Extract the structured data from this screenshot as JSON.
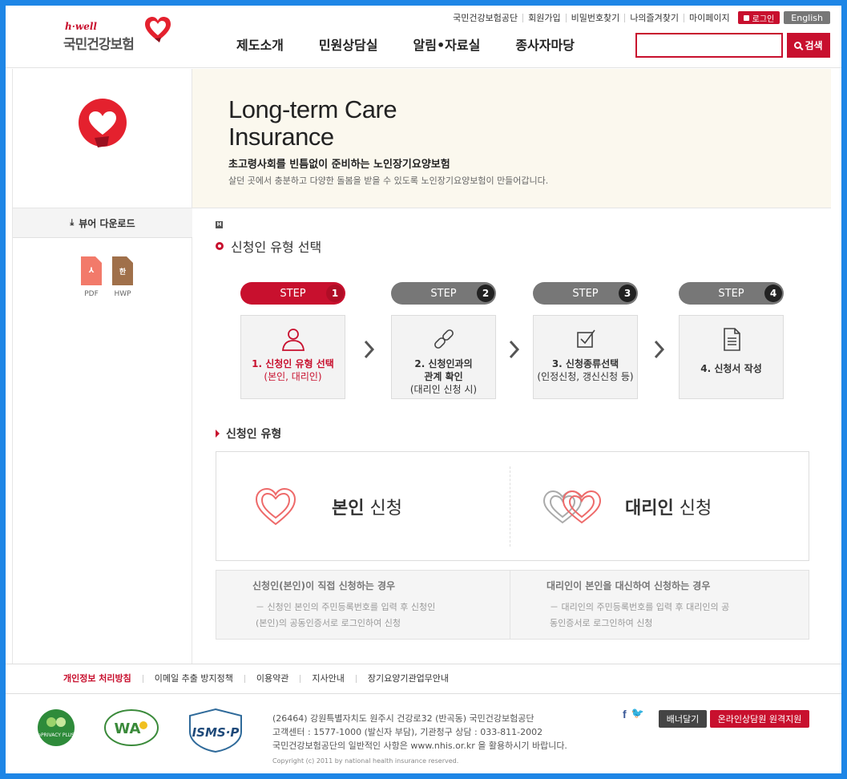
{
  "header": {
    "logo_tagline": "h·well",
    "logo_name": "국민건강보험",
    "util_links": [
      "국민건강보험공단",
      "회원가입",
      "비밀번호찾기",
      "나의즐겨찾기",
      "마이페이지"
    ],
    "login_label": "로그인",
    "english_label": "English",
    "menu": [
      "제도소개",
      "민원상담실",
      "알림•자료실",
      "종사자마당"
    ],
    "search_value": "",
    "search_label": "검색"
  },
  "banner": {
    "title_line1": "Long-term Care",
    "title_line2": "Insurance",
    "subtitle": "초고령사회를 빈틈없이 준비하는 노인장기요양보험",
    "description": "살던 곳에서 충분하고 다양한 돌봄을 받을 수 있도록 노인장기요양보험이 만들어갑니다."
  },
  "sidebar": {
    "viewer_title": "뷰어 다운로드",
    "downloads": [
      {
        "label": "PDF",
        "glyph": "⅄",
        "color": "#f27a6a",
        "icon": "pdf-icon"
      },
      {
        "label": "HWP",
        "glyph": "한",
        "color": "#a0704a",
        "icon": "hwp-icon"
      }
    ]
  },
  "page": {
    "heading": "신청인 유형 선택",
    "steps": [
      {
        "step": "STEP",
        "num": "1",
        "label": "1. 신청인 유형 선택",
        "sub": "(본인, 대리인)",
        "icon": "person-icon",
        "active": true
      },
      {
        "step": "STEP",
        "num": "2",
        "label": "2. 신청인과의 관계 확인",
        "sub": "(대리인 신청 시)",
        "icon": "link-icon",
        "active": false
      },
      {
        "step": "STEP",
        "num": "3",
        "label": "3. 신청종류선택",
        "sub": "(인정신청, 갱신신청 등)",
        "icon": "checkbox-icon",
        "active": false
      },
      {
        "step": "STEP",
        "num": "4",
        "label": "4. 신청서 작성",
        "sub": "",
        "icon": "document-icon",
        "active": false
      }
    ],
    "type_heading": "신청인 유형",
    "types": [
      {
        "bold": "본인",
        "rest": " 신청"
      },
      {
        "bold": "대리인",
        "rest": " 신청"
      }
    ],
    "descriptions": [
      {
        "title": "신청인(본인)이 직접 신청하는 경우",
        "line1": "－ 신청인 본인의 주민등록번호를 입력 후 신청인",
        "line2": "(본인)의 공동인증서로 로그인하여 신청"
      },
      {
        "title": "대리인이 본인을 대신하여 신청하는 경우",
        "line1": "－ 대리인의 주민등록번호를 입력 후 대리인의 공",
        "line2": "동인증서로 로그인하여 신청"
      }
    ]
  },
  "footer": {
    "links": [
      "개인정보 처리방침",
      "이메일 추출 방지정책",
      "이용약관",
      "지사안내",
      "장기요양기관업무안내"
    ],
    "address": "(26464) 강원특별자치도 원주시 건강로32 (반곡동) 국민건강보험공단",
    "callcenter": "고객센터 : 1577-1000 (발신자 부담), 기관청구 상담 : 033-811-2002",
    "notice": "국민건강보험공단의 일반적인 사항은 www.nhis.or.kr 을 활용하시기 바랍니다.",
    "copyright": "Copyright (c) 2011 by national health insurance reserved.",
    "banner_button": "배너달기",
    "consult_button": "온라인상담원 원격지원",
    "cert_texts": [
      "ePRIVACY PLUS",
      "WA",
      "ISMS·P"
    ]
  },
  "colors": {
    "brand_red": "#c8102e",
    "frame_blue": "#1e86e6"
  }
}
